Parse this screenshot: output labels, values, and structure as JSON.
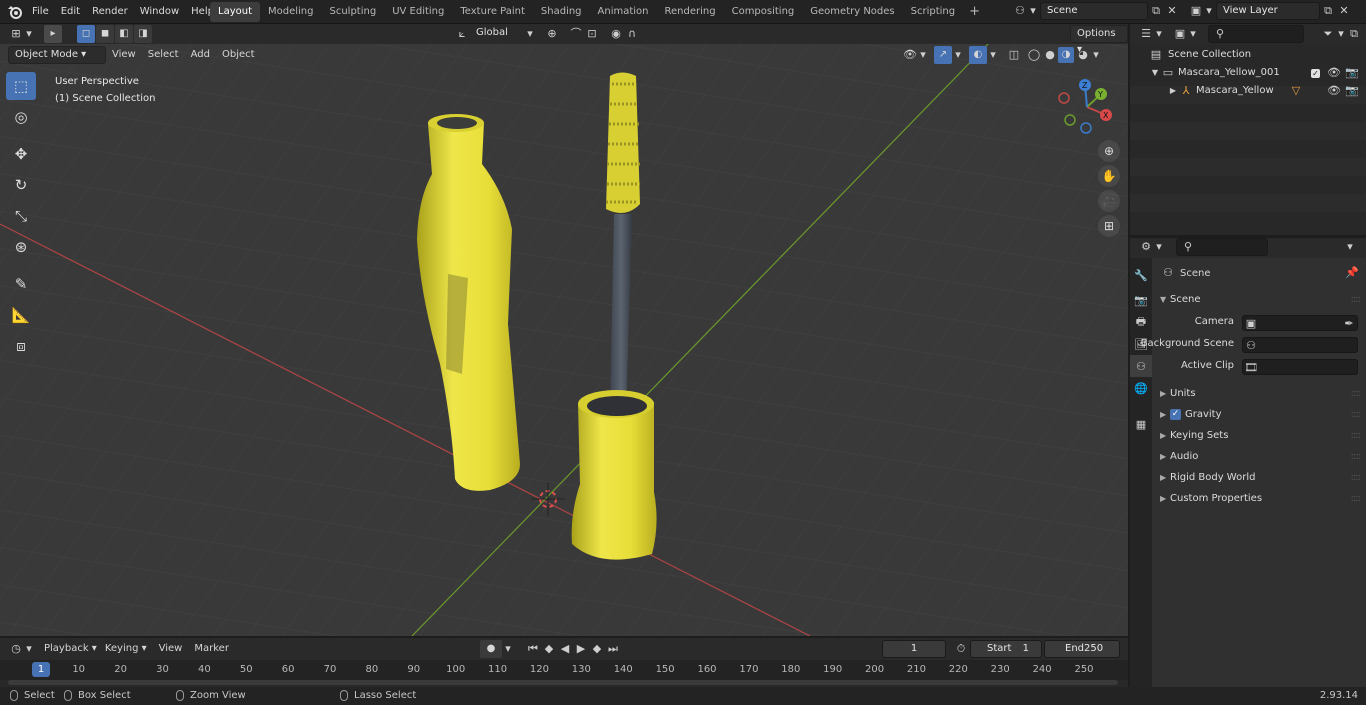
{
  "topbar": {
    "menus": [
      "File",
      "Edit",
      "Render",
      "Window",
      "Help"
    ],
    "workspaces": [
      "Layout",
      "Modeling",
      "Sculpting",
      "UV Editing",
      "Texture Paint",
      "Shading",
      "Animation",
      "Rendering",
      "Compositing",
      "Geometry Nodes",
      "Scripting"
    ],
    "active_workspace": "Layout",
    "scene": "Scene",
    "view_layer": "View Layer"
  },
  "viewport": {
    "mode": "Object Mode",
    "menus": [
      "View",
      "Select",
      "Add",
      "Object"
    ],
    "transform_orientation": "Global",
    "options_label": "Options",
    "perspective_label": "User Perspective",
    "collection_label": "(1) Scene Collection",
    "gizmo_axes": [
      "X",
      "Y",
      "Z"
    ]
  },
  "outliner": {
    "root": "Scene Collection",
    "items": [
      {
        "name": "Mascara_Yellow_001",
        "depth": 1
      },
      {
        "name": "Mascara_Yellow",
        "depth": 2
      }
    ]
  },
  "properties": {
    "context": "Scene",
    "panel_title": "Scene",
    "fields": [
      {
        "label": "Camera"
      },
      {
        "label": "Background Scene"
      },
      {
        "label": "Active Clip"
      }
    ],
    "sections": [
      "Units",
      "Gravity",
      "Keying Sets",
      "Audio",
      "Rigid Body World",
      "Custom Properties"
    ]
  },
  "timeline": {
    "menus": [
      "Playback",
      "Keying",
      "View",
      "Marker"
    ],
    "current_frame": "1",
    "start_label": "Start",
    "start": "1",
    "end_label": "End",
    "end": "250",
    "ticks": [
      "1",
      "10",
      "20",
      "30",
      "40",
      "50",
      "60",
      "70",
      "80",
      "90",
      "100",
      "110",
      "120",
      "130",
      "140",
      "150",
      "160",
      "170",
      "180",
      "190",
      "200",
      "210",
      "220",
      "230",
      "240",
      "250"
    ]
  },
  "status": {
    "select": "Select",
    "box_select": "Box Select",
    "zoom_view": "Zoom View",
    "lasso_select": "Lasso Select",
    "version": "2.93.14"
  },
  "colors": {
    "accent": "#4772b3",
    "viewport_bg": "#393939",
    "mascara_yellow": "#e8e03a",
    "x_axis": "#c04848",
    "y_axis": "#6c9c2c"
  }
}
